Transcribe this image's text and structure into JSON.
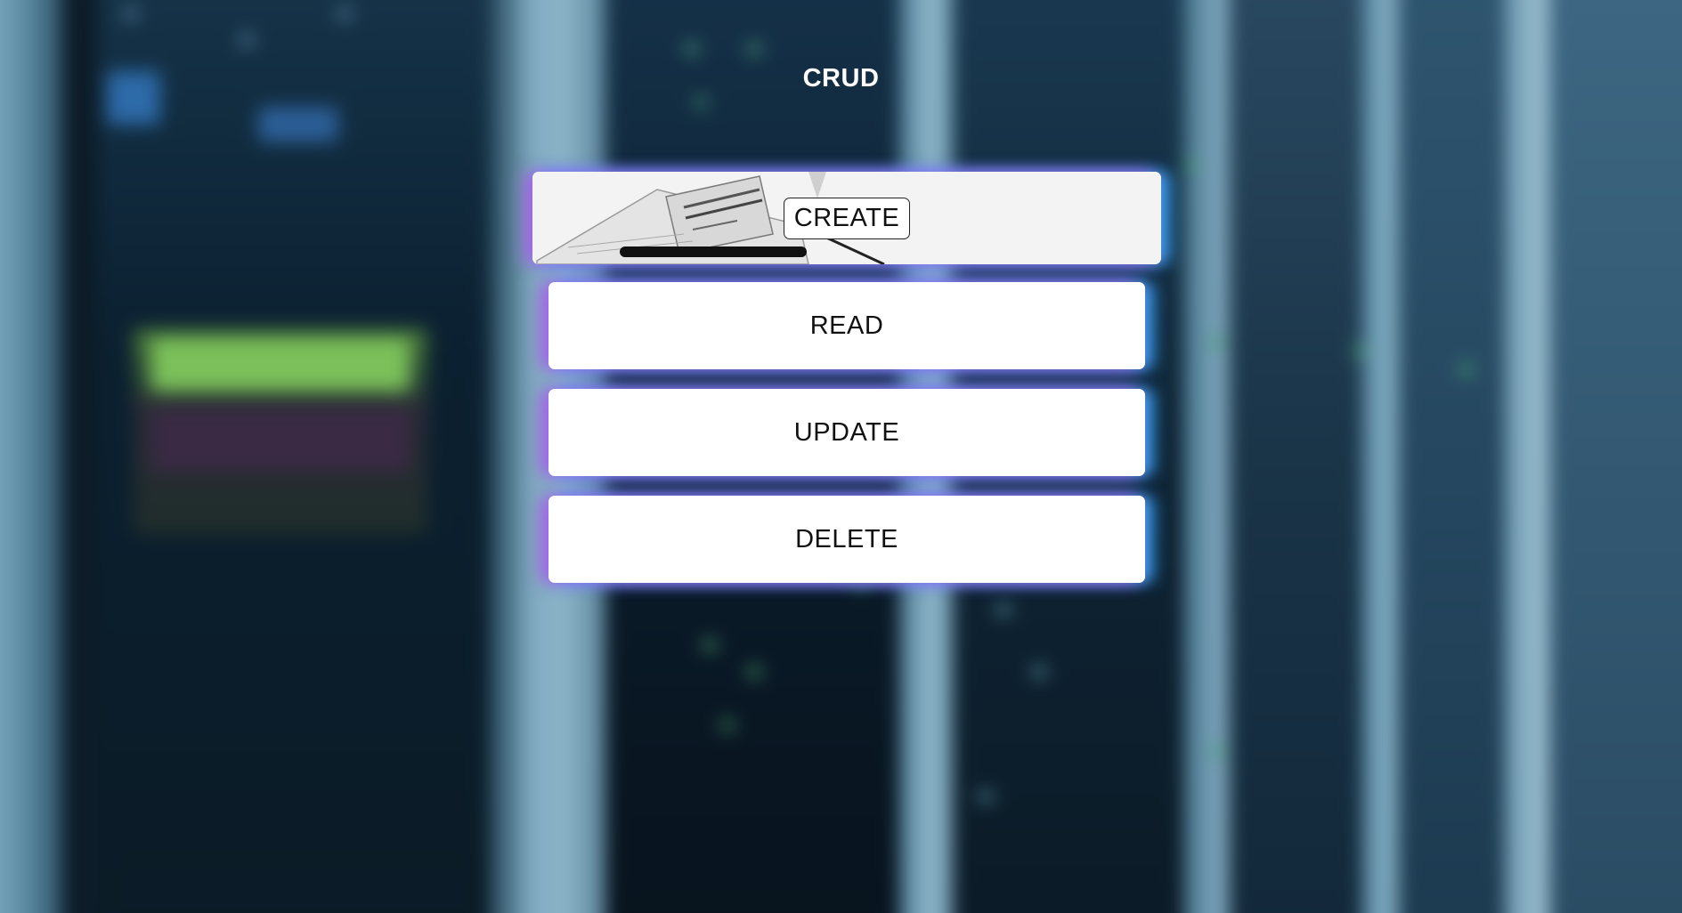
{
  "page": {
    "title": "CRUD"
  },
  "menu": {
    "create_label": "CREATE",
    "read_label": "READ",
    "update_label": "UPDATE",
    "delete_label": "DELETE"
  },
  "theme": {
    "glow_left": "#aa5ae6",
    "glow_right": "#3caaff",
    "card_background": "#ffffff",
    "text_color": "#111111",
    "title_color": "#ffffff"
  },
  "background": {
    "description_icon": "server-room-photo"
  }
}
